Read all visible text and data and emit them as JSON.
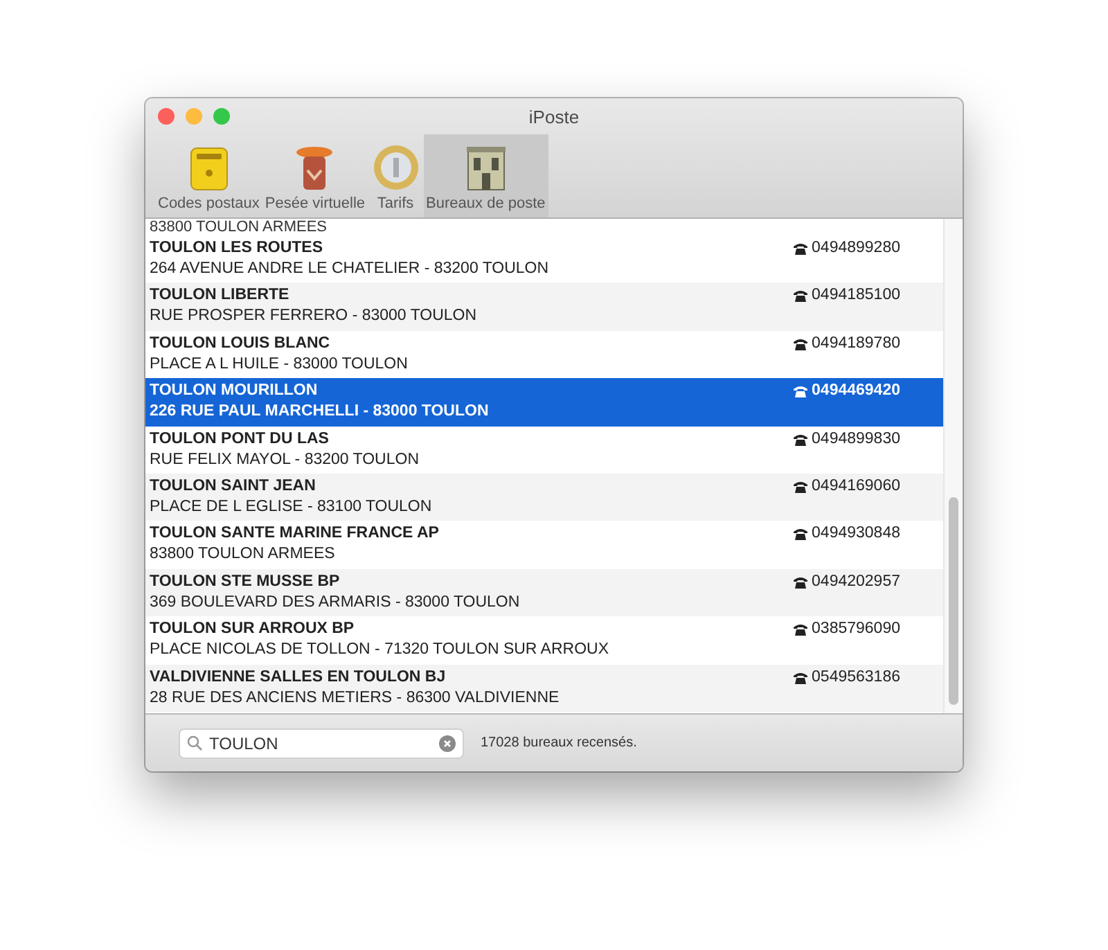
{
  "window": {
    "title": "iPoste"
  },
  "toolbar": [
    {
      "label": "Codes postaux",
      "kind": "mailbox",
      "selected": false
    },
    {
      "label": "Pesée virtuelle",
      "kind": "scale",
      "selected": false
    },
    {
      "label": "Tarifs",
      "kind": "coin",
      "selected": false
    },
    {
      "label": "Bureaux de poste",
      "kind": "building",
      "selected": true
    }
  ],
  "partial_row": {
    "address": "83800 TOULON ARMEES"
  },
  "offices": [
    {
      "name": "TOULON LES ROUTES",
      "address": "264 AVENUE ANDRE LE CHATELIER - 83200 TOULON",
      "phone": "0494899280",
      "selected": false
    },
    {
      "name": "TOULON LIBERTE",
      "address": "RUE PROSPER FERRERO - 83000 TOULON",
      "phone": "0494185100",
      "selected": false
    },
    {
      "name": "TOULON LOUIS BLANC",
      "address": "PLACE A L HUILE - 83000 TOULON",
      "phone": "0494189780",
      "selected": false
    },
    {
      "name": "TOULON MOURILLON",
      "address": "226 RUE PAUL MARCHELLI - 83000 TOULON",
      "phone": "0494469420",
      "selected": true
    },
    {
      "name": "TOULON PONT DU LAS",
      "address": "RUE FELIX MAYOL - 83200 TOULON",
      "phone": "0494899830",
      "selected": false
    },
    {
      "name": "TOULON SAINT JEAN",
      "address": "PLACE DE L EGLISE - 83100 TOULON",
      "phone": "0494169060",
      "selected": false
    },
    {
      "name": "TOULON SANTE MARINE FRANCE AP",
      "address": "83800 TOULON ARMEES",
      "phone": "0494930848",
      "selected": false
    },
    {
      "name": "TOULON STE MUSSE BP",
      "address": "369 BOULEVARD DES ARMARIS - 83000 TOULON",
      "phone": "0494202957",
      "selected": false
    },
    {
      "name": "TOULON SUR ARROUX BP",
      "address": "PLACE NICOLAS DE TOLLON - 71320 TOULON SUR ARROUX",
      "phone": "0385796090",
      "selected": false
    },
    {
      "name": "VALDIVIENNE SALLES EN TOULON BJ",
      "address": "28 RUE DES ANCIENS METIERS - 86300 VALDIVIENNE",
      "phone": "0549563186",
      "selected": false
    }
  ],
  "search": {
    "value": "TOULON"
  },
  "status": "17028 bureaux recensés."
}
